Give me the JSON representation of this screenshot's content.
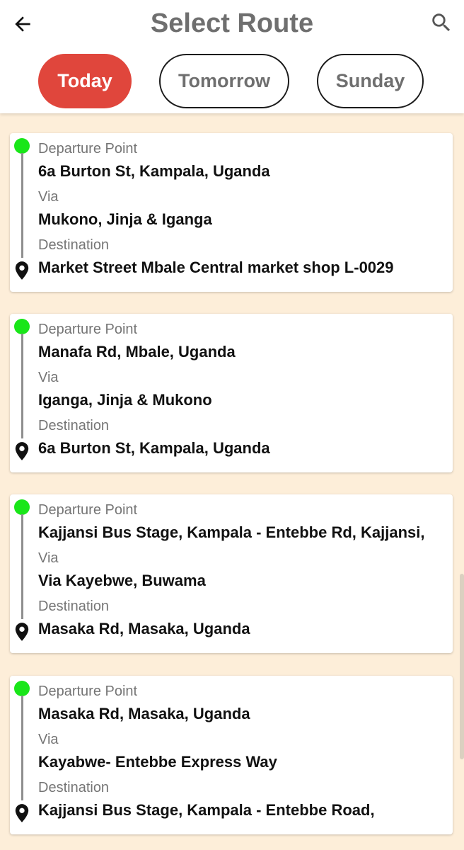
{
  "header": {
    "title": "Select Route",
    "back_icon": "arrow-left-icon",
    "search_icon": "search-icon"
  },
  "day_tabs": [
    {
      "label": "Today",
      "active": true
    },
    {
      "label": "Tomorrow",
      "active": false
    },
    {
      "label": "Sunday",
      "active": false
    }
  ],
  "labels": {
    "departure": "Departure Point",
    "via": "Via",
    "destination": "Destination"
  },
  "routes": [
    {
      "departure": "6a Burton St, Kampala, Uganda",
      "via": "Mukono, Jinja & Iganga",
      "destination": "Market Street Mbale Central market shop L-0029"
    },
    {
      "departure": "Manafa Rd, Mbale, Uganda",
      "via": "Iganga, Jinja & Mukono",
      "destination": "6a Burton St, Kampala, Uganda"
    },
    {
      "departure": "Kajjansi Bus Stage, Kampala - Entebbe Rd, Kajjansi,",
      "via": "Via Kayebwe, Buwama",
      "destination": "Masaka Rd, Masaka, Uganda"
    },
    {
      "departure": "Masaka Rd, Masaka, Uganda",
      "via": "Kayabwe- Entebbe Express Way",
      "destination": "Kajjansi Bus Stage, Kampala - Entebbe Road,"
    }
  ],
  "colors": {
    "accent": "#e0463c",
    "start_dot": "#19e619",
    "background": "#fdeed9"
  }
}
